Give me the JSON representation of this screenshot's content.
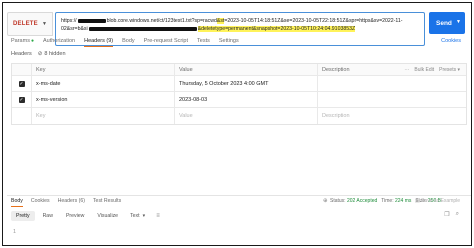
{
  "request": {
    "method": "DELETE",
    "url_line1_prefix": "https://",
    "url_line1_mid": "blob.core.windows.net/ct/123test1.txt?sp=racwd",
    "url_line1_mark": "&st",
    "url_line1_rest": "=2023-10-05T14:18:51Z&se=2023-10-05T22:18:51Z&spr=https&sv=2022-11-",
    "url_line2_prefix": "02&sr=b&si",
    "url_line2_highlight": "&deletetype=permanent&snapshot=2023-10-05T10:24:04.9103853Z",
    "send_label": "Send"
  },
  "tabs": [
    {
      "label": "Params",
      "dot": "●"
    },
    {
      "label": "Authorization"
    },
    {
      "label": "Headers (9)"
    },
    {
      "label": "Body"
    },
    {
      "label": "Pre-request Script"
    },
    {
      "label": "Tests"
    },
    {
      "label": "Settings"
    }
  ],
  "cookies_label": "Cookies",
  "headers_label": "Headers",
  "hidden_label": "8 hidden",
  "table": {
    "headers": {
      "key": "Key",
      "value": "Value",
      "description": "Description",
      "bulk_edit": "Bulk Edit",
      "presets": "Presets"
    },
    "rows": [
      {
        "key": "x-ms-date",
        "value": "Thursday, 5 October 2023 4:00 GMT"
      },
      {
        "key": "x-ms-version",
        "value": "2023-08-03"
      }
    ],
    "placeholder": {
      "key": "Key",
      "value": "Value",
      "description": "Description"
    }
  },
  "response": {
    "tabs": [
      "Body",
      "Cookies",
      "Headers (6)",
      "Test Results"
    ],
    "status_label": "Status:",
    "status": "202 Accepted",
    "time_label": "Time:",
    "time": "224 ms",
    "size_label": "Size:",
    "size": "250 B",
    "save_label": "Save as Example",
    "modes": [
      "Pretty",
      "Raw",
      "Preview",
      "Visualize"
    ],
    "format": "Text",
    "line_number": "1"
  }
}
